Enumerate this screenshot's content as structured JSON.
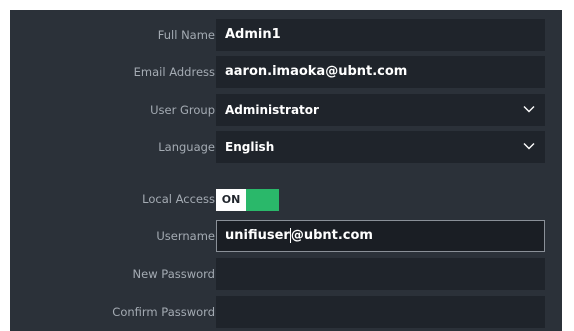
{
  "form": {
    "full_name": {
      "label": "Full Name",
      "value": "Admin1"
    },
    "email": {
      "label": "Email Address",
      "value": "aaron.imaoka@ubnt.com"
    },
    "user_group": {
      "label": "User Group",
      "value": "Administrator",
      "icon": "chevron-down-icon"
    },
    "language": {
      "label": "Language",
      "value": "English",
      "icon": "chevron-down-icon"
    },
    "local_access": {
      "label": "Local Access",
      "state": "ON",
      "enabled": true,
      "accent": "#2ab86a"
    },
    "username": {
      "label": "Username",
      "value_before_cursor": "unifiuser",
      "value_after_cursor": "@ubnt.com"
    },
    "new_password": {
      "label": "New Password",
      "value": ""
    },
    "confirm_password": {
      "label": "Confirm Password",
      "value": ""
    }
  },
  "colors": {
    "panel_bg": "#2b3139",
    "field_bg": "#1f242b",
    "label_text": "#a4abb3",
    "value_text": "#ffffff",
    "toggle_on": "#2ab86a"
  }
}
